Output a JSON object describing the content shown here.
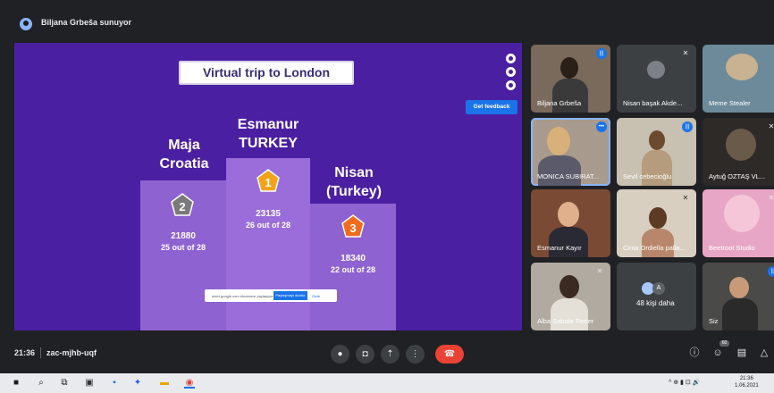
{
  "presenter": {
    "label": "Biljana Grbeša sunuyor"
  },
  "slide": {
    "title": "Virtual trip to London",
    "feedback_button": "Get feedback",
    "podium": [
      {
        "name_line1": "Esmanur",
        "name_line2": "TURKEY",
        "rank": "1",
        "score": "23135",
        "out_of": "26 out of 28"
      },
      {
        "name_line1": "Maja",
        "name_line2": "Croatia",
        "rank": "2",
        "score": "21880",
        "out_of": "25 out of 28"
      },
      {
        "name_line1": "Nisan",
        "name_line2": "(Turkey)",
        "rank": "3",
        "score": "18340",
        "out_of": "22 out of 28"
      }
    ],
    "notice": {
      "text": "meet.google.com ekranınızı paylaşıyor.",
      "button": "Paylaşmayı durdur",
      "link": "Gizle"
    }
  },
  "participants": [
    {
      "name": "Biljana Grbeša",
      "status": "speaking"
    },
    {
      "name": "Nisan başak Akde...",
      "status": "muted"
    },
    {
      "name": "Meme Stealer",
      "status": "none"
    },
    {
      "name": "MONICA SUBIRAT...",
      "status": "more"
    },
    {
      "name": "Sevil cebecioğlu",
      "status": "speaking"
    },
    {
      "name": "Aytuğ OZTAŞ VL...",
      "status": "muted"
    },
    {
      "name": "Esmanur Kayır",
      "status": "none"
    },
    {
      "name": "Cinta Ordiella palla...",
      "status": "muted"
    },
    {
      "name": "Beetroot Studio",
      "status": "muted"
    },
    {
      "name": "Alba Sabate Ferrer",
      "status": "muted"
    },
    {
      "name": "48 kişi daha",
      "avatar_letter": "A"
    },
    {
      "name": "Siz",
      "status": "speaking"
    }
  ],
  "bottombar": {
    "time": "21:36",
    "meeting_code": "zac-mjhb-uqf",
    "participant_count": "60",
    "controls": [
      "microphone-icon",
      "camera-icon",
      "present-icon",
      "more-icon",
      "end-call-icon"
    ],
    "right": [
      "info-icon",
      "people-icon",
      "chat-icon",
      "activities-icon"
    ]
  },
  "taskbar": {
    "time": "21:36",
    "date": "1.06.2021",
    "tray": "^ ⊕ ▮ ⊡ 🔊"
  },
  "colors": {
    "slide_bg": "#4b1fa1",
    "pod": "#8e62d0",
    "gold": "#f2a31a",
    "silver": "#7a7a7a",
    "bronze": "#f26a1c",
    "accent": "#1a73e8",
    "end_call": "#ea4335"
  }
}
